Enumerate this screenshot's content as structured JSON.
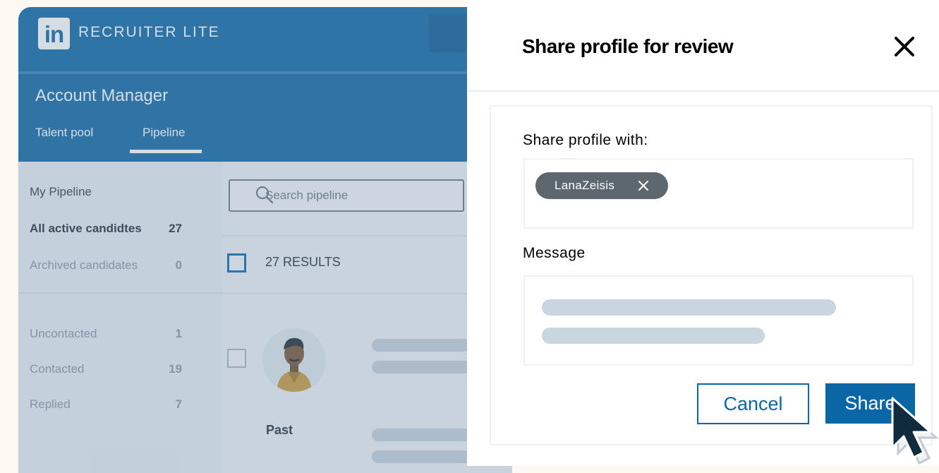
{
  "app": {
    "logo_text": "in",
    "brand": "RECRUITER LITE",
    "account_title": "Account Manager",
    "tabs": [
      {
        "label": "Talent pool"
      },
      {
        "label": "Pipeline",
        "active": true
      }
    ]
  },
  "sidebar": {
    "section_title": "My Pipeline",
    "items": [
      {
        "label": "All active candidtes",
        "count": "27"
      },
      {
        "label": "Archived candidates",
        "count": "0"
      },
      {
        "label": "Uncontacted",
        "count": "1"
      },
      {
        "label": "Contacted",
        "count": "19"
      },
      {
        "label": "Replied",
        "count": "7"
      }
    ]
  },
  "main": {
    "search_placeholder": "Search pipeline",
    "results_label": "27 RESULTS",
    "candidate_section_label": "Past"
  },
  "modal": {
    "title": "Share profile for review",
    "share_with_label": "Share profile with:",
    "recipient_chip": "LanaZeisis",
    "message_label": "Message",
    "cancel_label": "Cancel",
    "share_label": "Share"
  },
  "icons": {
    "close": "close-icon",
    "chip_remove": "x-icon",
    "search": "search-icon",
    "cursor": "mouse-pointer-icon",
    "avatar": "person-avatar"
  },
  "colors": {
    "brand_blue": "#0b66a6",
    "chip_bg": "#5c6770",
    "page_bg": "#fdf8f2"
  }
}
